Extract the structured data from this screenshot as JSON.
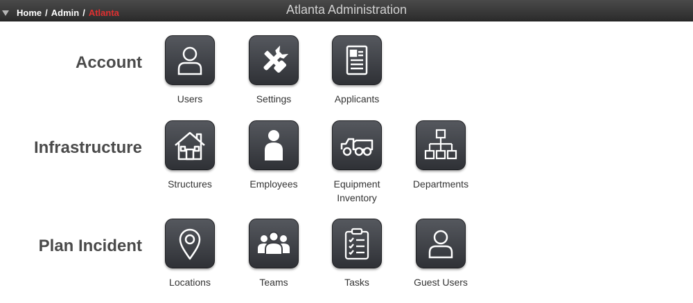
{
  "header": {
    "title": "Atlanta Administration",
    "breadcrumb": [
      {
        "label": "Home"
      },
      {
        "label": "Admin"
      },
      {
        "label": "Atlanta"
      }
    ],
    "breadcrumb_separator": "/",
    "colors": {
      "bar": "#333333",
      "current_crumb": "#e03030"
    }
  },
  "sections": [
    {
      "label": "Account",
      "tiles": [
        {
          "label": "Users",
          "icon": "user-icon"
        },
        {
          "label": "Settings",
          "icon": "tools-icon"
        },
        {
          "label": "Applicants",
          "icon": "id-card-icon"
        }
      ]
    },
    {
      "label": "Infrastructure",
      "tiles": [
        {
          "label": "Structures",
          "icon": "house-icon"
        },
        {
          "label": "Employees",
          "icon": "person-icon"
        },
        {
          "label": "Equipment Inventory",
          "icon": "truck-icon"
        },
        {
          "label": "Departments",
          "icon": "org-chart-icon"
        }
      ]
    },
    {
      "label": "Plan Incident",
      "tiles": [
        {
          "label": "Locations",
          "icon": "map-pin-icon"
        },
        {
          "label": "Teams",
          "icon": "group-icon"
        },
        {
          "label": "Tasks",
          "icon": "checklist-icon"
        },
        {
          "label": "Guest Users",
          "icon": "user-icon"
        }
      ]
    }
  ]
}
